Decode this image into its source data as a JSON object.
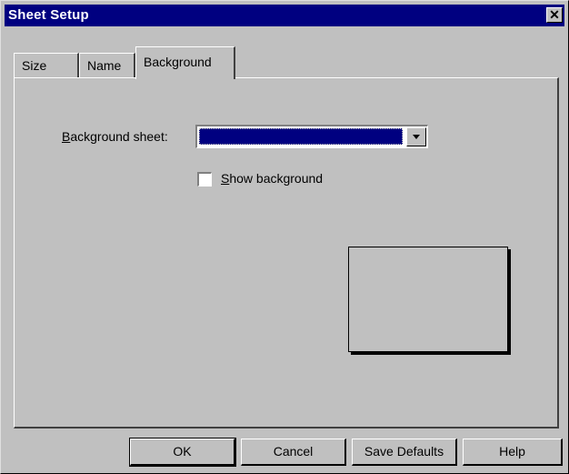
{
  "window": {
    "title": "Sheet Setup",
    "close_glyph": "✕"
  },
  "tabs": [
    {
      "label": "Size"
    },
    {
      "label": "Name"
    },
    {
      "label": "Background",
      "active": true
    }
  ],
  "background": {
    "sheet_label_mnemonic": "B",
    "sheet_label_rest": "ackground sheet:",
    "sheet_value": "",
    "show_label_mnemonic": "S",
    "show_label_rest": "how background",
    "show_checked": false
  },
  "buttons": {
    "ok": "OK",
    "cancel": "Cancel",
    "save_defaults": "Save Defaults",
    "help": "Help"
  },
  "colors": {
    "title_bar": "#000080",
    "dialog_face": "#c0c0c0",
    "selection": "#000080"
  },
  "icons": {
    "dropdown": "chevron-down-icon",
    "close": "close-icon"
  }
}
